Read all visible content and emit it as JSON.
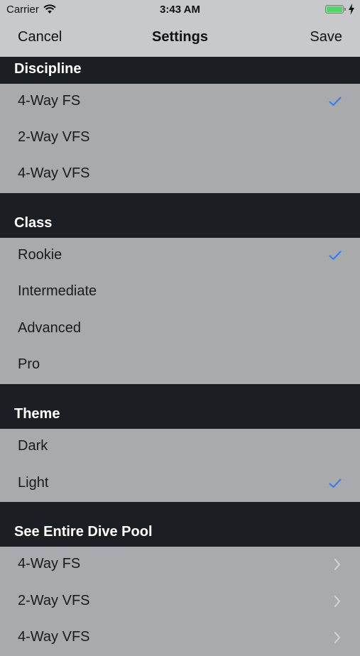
{
  "status_bar": {
    "carrier": "Carrier",
    "time": "3:43 AM"
  },
  "nav": {
    "cancel": "Cancel",
    "title": "Settings",
    "save": "Save"
  },
  "sections": {
    "discipline": {
      "title": "Discipline",
      "items": [
        "4-Way FS",
        "2-Way VFS",
        "4-Way VFS"
      ],
      "selected": "4-Way FS"
    },
    "class": {
      "title": "Class",
      "items": [
        "Rookie",
        "Intermediate",
        "Advanced",
        "Pro"
      ],
      "selected": "Rookie"
    },
    "theme": {
      "title": "Theme",
      "items": [
        "Dark",
        "Light"
      ],
      "selected": "Light"
    },
    "dive_pool": {
      "title": "See Entire Dive Pool",
      "items": [
        "4-Way FS",
        "2-Way VFS",
        "4-Way VFS"
      ]
    }
  },
  "colors": {
    "accent": "#2f7cf6",
    "header_bg": "#1b1e22",
    "row_bg": "#a9aaac",
    "bar_bg": "#c8c9cb"
  },
  "icons": {
    "check": "checkmark-icon",
    "chevron": "chevron-right-icon",
    "wifi": "wifi-icon",
    "battery": "battery-icon"
  }
}
